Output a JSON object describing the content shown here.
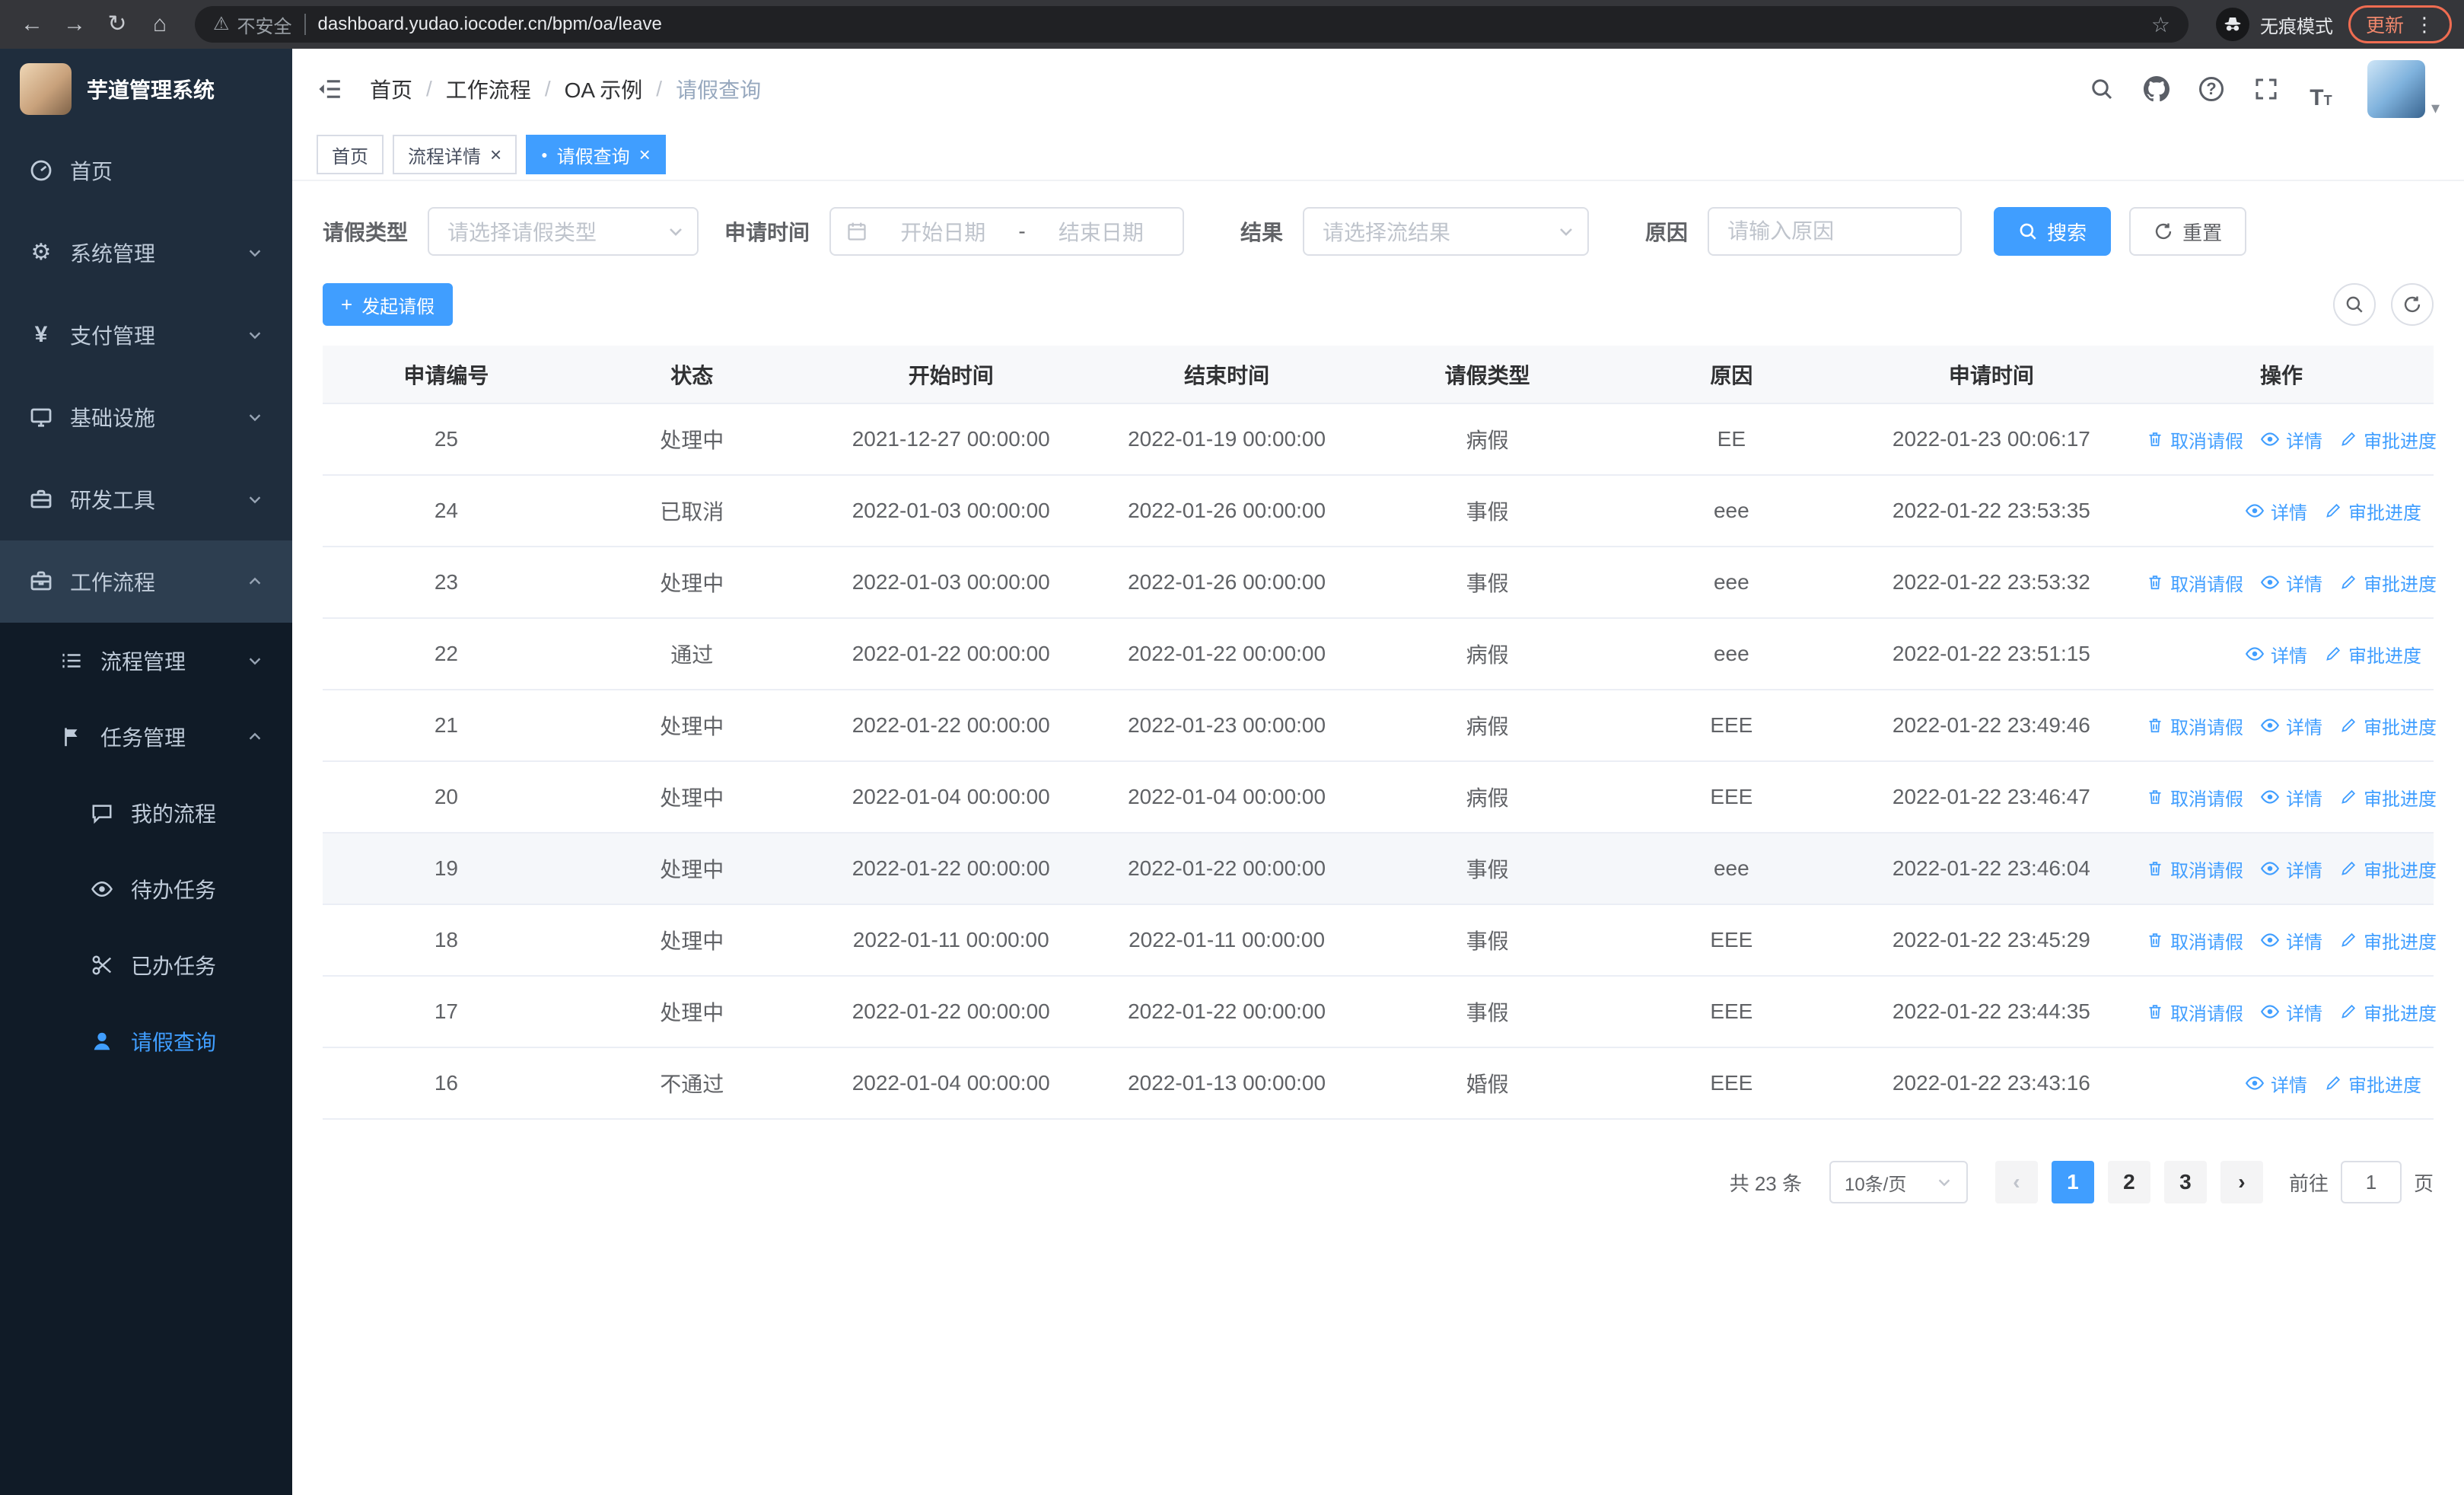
{
  "icons": {
    "back": "←",
    "forward": "→",
    "reload": "↻",
    "home": "⌂",
    "warning": "⚠",
    "star": "☆",
    "menu_dots": "⋮",
    "gear": "⚙",
    "yen": "¥",
    "plus": "+",
    "caret_down": "▾",
    "tab_dot": "●",
    "close": "×",
    "prev": "‹",
    "next": "›",
    "crumb_sep": "/",
    "font_size": "T"
  },
  "browser": {
    "security_label": "不安全",
    "url": "dashboard.yudao.iocoder.cn/bpm/oa/leave",
    "incognito_label": "无痕模式",
    "update_label": "更新"
  },
  "sidebar": {
    "logo_title": "芋道管理系统",
    "items": [
      {
        "label": "首页"
      },
      {
        "label": "系统管理"
      },
      {
        "label": "支付管理"
      },
      {
        "label": "基础设施"
      },
      {
        "label": "研发工具"
      },
      {
        "label": "工作流程"
      }
    ],
    "submenu": [
      {
        "label": "流程管理"
      },
      {
        "label": "任务管理"
      }
    ],
    "tasks_children": [
      {
        "label": "我的流程"
      },
      {
        "label": "待办任务"
      },
      {
        "label": "已办任务"
      },
      {
        "label": "请假查询"
      }
    ]
  },
  "topbar": {
    "breadcrumb": [
      {
        "label": "首页"
      },
      {
        "label": "工作流程"
      },
      {
        "label": "OA 示例"
      },
      {
        "label": "请假查询"
      }
    ]
  },
  "tabs": [
    {
      "label": "首页"
    },
    {
      "label": "流程详情"
    },
    {
      "label": "请假查询"
    }
  ],
  "filters": {
    "leave_type_label": "请假类型",
    "leave_type_placeholder": "请选择请假类型",
    "apply_time_label": "申请时间",
    "start_date_placeholder": "开始日期",
    "range_separator": "-",
    "end_date_placeholder": "结束日期",
    "result_label": "结果",
    "result_placeholder": "请选择流结果",
    "reason_label": "原因",
    "reason_placeholder": "请输入原因",
    "search_button": "搜索",
    "reset_button": "重置"
  },
  "toolbar": {
    "create_button": "发起请假"
  },
  "table": {
    "columns": [
      "申请编号",
      "状态",
      "开始时间",
      "结束时间",
      "请假类型",
      "原因",
      "申请时间",
      "操作"
    ],
    "action_labels": {
      "cancel": "取消请假",
      "detail": "详情",
      "progress": "审批进度"
    },
    "rows": [
      {
        "id": "25",
        "status": "处理中",
        "start": "2021-12-27 00:00:00",
        "end": "2022-01-19 00:00:00",
        "type": "病假",
        "reason": "EE",
        "applied": "2022-01-23 00:06:17"
      },
      {
        "id": "24",
        "status": "已取消",
        "start": "2022-01-03 00:00:00",
        "end": "2022-01-26 00:00:00",
        "type": "事假",
        "reason": "eee",
        "applied": "2022-01-22 23:53:35"
      },
      {
        "id": "23",
        "status": "处理中",
        "start": "2022-01-03 00:00:00",
        "end": "2022-01-26 00:00:00",
        "type": "事假",
        "reason": "eee",
        "applied": "2022-01-22 23:53:32"
      },
      {
        "id": "22",
        "status": "通过",
        "start": "2022-01-22 00:00:00",
        "end": "2022-01-22 00:00:00",
        "type": "病假",
        "reason": "eee",
        "applied": "2022-01-22 23:51:15"
      },
      {
        "id": "21",
        "status": "处理中",
        "start": "2022-01-22 00:00:00",
        "end": "2022-01-23 00:00:00",
        "type": "病假",
        "reason": "EEE",
        "applied": "2022-01-22 23:49:46"
      },
      {
        "id": "20",
        "status": "处理中",
        "start": "2022-01-04 00:00:00",
        "end": "2022-01-04 00:00:00",
        "type": "病假",
        "reason": "EEE",
        "applied": "2022-01-22 23:46:47"
      },
      {
        "id": "19",
        "status": "处理中",
        "start": "2022-01-22 00:00:00",
        "end": "2022-01-22 00:00:00",
        "type": "事假",
        "reason": "eee",
        "applied": "2022-01-22 23:46:04"
      },
      {
        "id": "18",
        "status": "处理中",
        "start": "2022-01-11 00:00:00",
        "end": "2022-01-11 00:00:00",
        "type": "事假",
        "reason": "EEE",
        "applied": "2022-01-22 23:45:29"
      },
      {
        "id": "17",
        "status": "处理中",
        "start": "2022-01-22 00:00:00",
        "end": "2022-01-22 00:00:00",
        "type": "事假",
        "reason": "EEE",
        "applied": "2022-01-22 23:44:35"
      },
      {
        "id": "16",
        "status": "不通过",
        "start": "2022-01-04 00:00:00",
        "end": "2022-01-13 00:00:00",
        "type": "婚假",
        "reason": "EEE",
        "applied": "2022-01-22 23:43:16"
      }
    ]
  },
  "pagination": {
    "total_text": "共 23 条",
    "page_size": "10条/页",
    "pages": [
      "1",
      "2",
      "3"
    ],
    "goto_label": "前往",
    "goto_value": "1",
    "goto_suffix": "页"
  }
}
